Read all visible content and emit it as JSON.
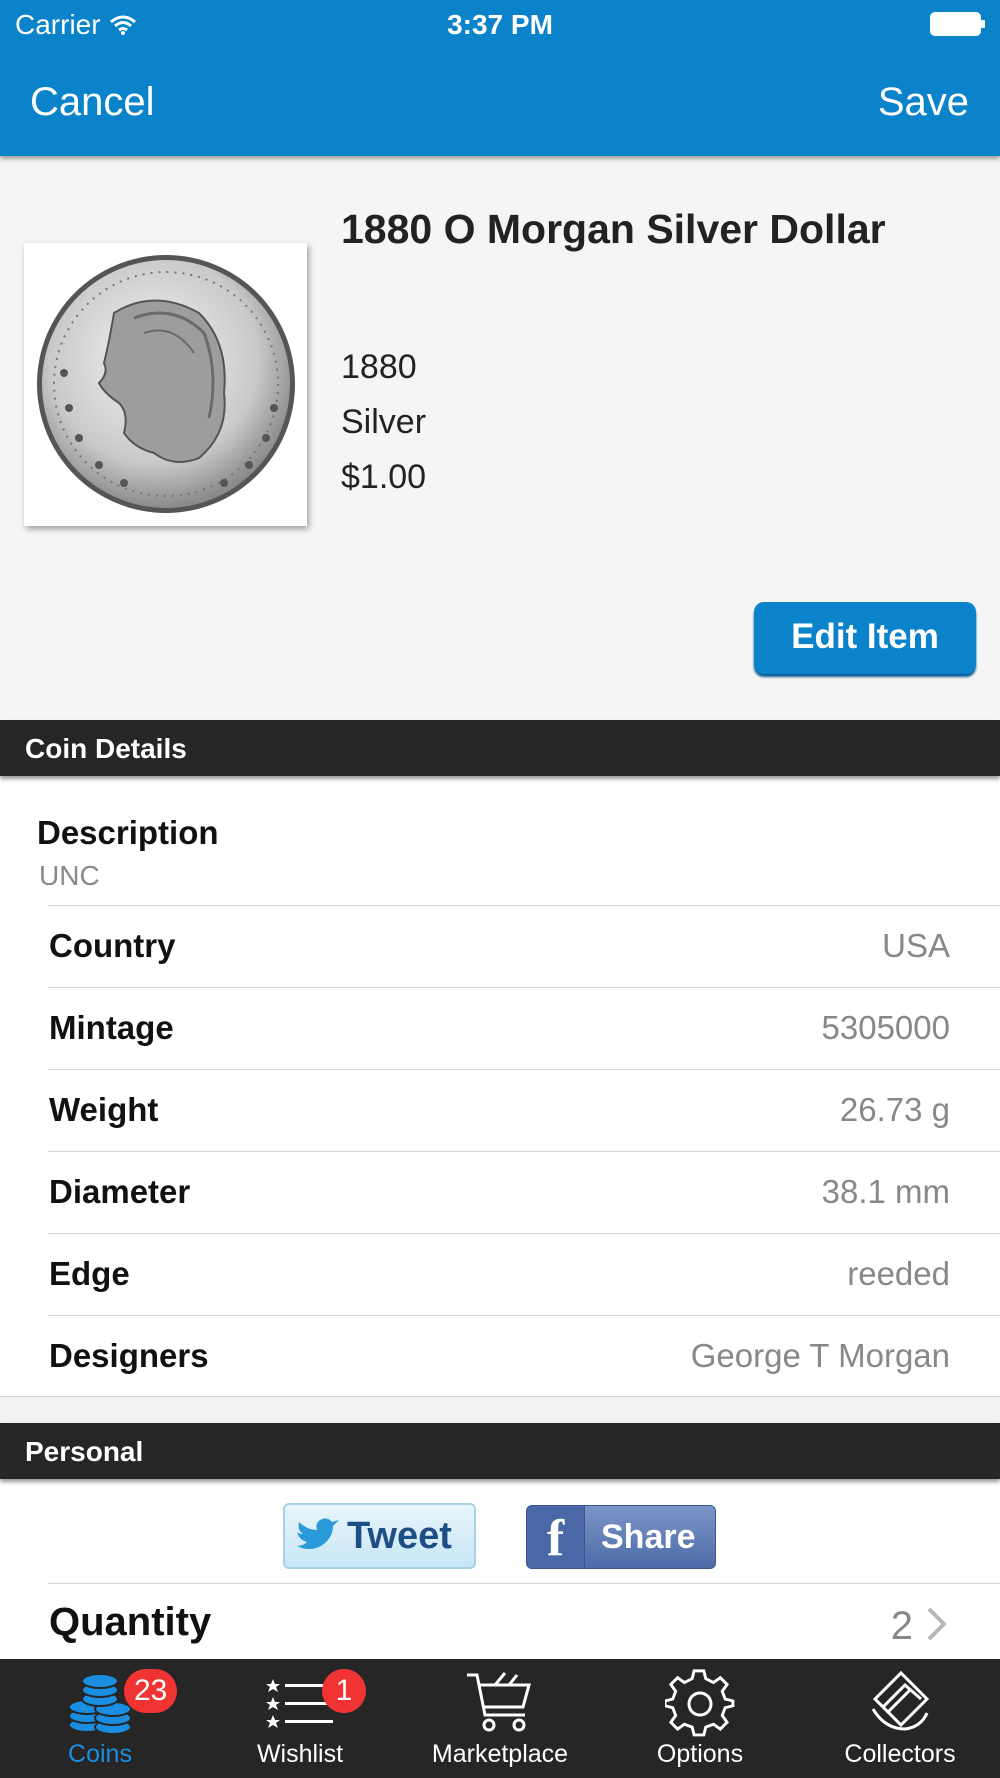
{
  "status_bar": {
    "carrier": "Carrier",
    "time": "3:37 PM"
  },
  "nav": {
    "cancel_label": "Cancel",
    "save_label": "Save"
  },
  "coin": {
    "title": "1880 O Morgan Silver Dollar",
    "year": "1880",
    "composition": "Silver",
    "face_value": "$1.00",
    "edit_label": "Edit Item",
    "image_icon": "morgan-dollar-coin-image"
  },
  "sections": {
    "coin_details": "Coin Details",
    "personal": "Personal"
  },
  "description": {
    "label": "Description",
    "value": "UNC"
  },
  "details": [
    {
      "key": "Country",
      "value": "USA"
    },
    {
      "key": "Mintage",
      "value": "5305000"
    },
    {
      "key": "Weight",
      "value": "26.73 g"
    },
    {
      "key": "Diameter",
      "value": "38.1 mm"
    },
    {
      "key": "Edge",
      "value": "reeded"
    },
    {
      "key": "Designers",
      "value": "George T Morgan"
    }
  ],
  "personal": {
    "tweet_label": "Tweet",
    "share_label": "Share",
    "quantity_label": "Quantity",
    "quantity_value": "2"
  },
  "tabbar": {
    "items": [
      {
        "label": "Coins",
        "icon": "coin-stack-icon",
        "badge": "23",
        "active": true
      },
      {
        "label": "Wishlist",
        "icon": "star-list-icon",
        "badge": "1",
        "active": false
      },
      {
        "label": "Marketplace",
        "icon": "cart-icon",
        "badge": "",
        "active": false
      },
      {
        "label": "Options",
        "icon": "gear-icon",
        "badge": "",
        "active": false
      },
      {
        "label": "Collectors",
        "icon": "collectors-icon",
        "badge": "",
        "active": false
      }
    ]
  },
  "colors": {
    "accent": "#0a83cb",
    "section_header": "#262626",
    "badge": "#f23333",
    "active_tab": "#1a8ee0"
  }
}
